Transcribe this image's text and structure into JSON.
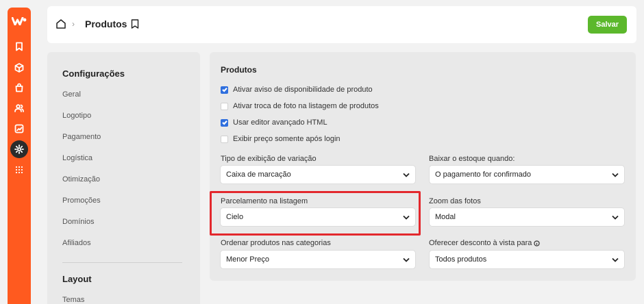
{
  "rail": {
    "items": [
      "bookmark-icon",
      "box-icon",
      "bag-icon",
      "users-icon",
      "chart-icon",
      "gear-icon",
      "grid-icon"
    ],
    "active": "gear-icon",
    "color": "#ff5a1f"
  },
  "header": {
    "page_title": "Produtos",
    "save_label": "Salvar"
  },
  "sidebar": {
    "section1": "Configurações",
    "items": [
      "Geral",
      "Logotipo",
      "Pagamento",
      "Logística",
      "Otimização",
      "Promoções",
      "Domínios",
      "Afiliados"
    ],
    "section2": "Layout",
    "items2": [
      "Temas"
    ]
  },
  "panel": {
    "title": "Produtos",
    "checkboxes": [
      {
        "label": "Ativar aviso de disponibilidade de produto",
        "checked": true
      },
      {
        "label": "Ativar troca de foto na listagem de produtos",
        "checked": false
      },
      {
        "label": "Usar editor avançado HTML",
        "checked": true
      },
      {
        "label": "Exibir preço somente após login",
        "checked": false
      }
    ],
    "fields": {
      "variacao": {
        "label": "Tipo de exibição de variação",
        "value": "Caixa de marcação"
      },
      "estoque": {
        "label": "Baixar o estoque quando:",
        "value": "O pagamento for confirmado"
      },
      "parcelamento": {
        "label": "Parcelamento na listagem",
        "value": "Cielo"
      },
      "zoom": {
        "label": "Zoom das fotos",
        "value": "Modal"
      },
      "ordenar": {
        "label": "Ordenar produtos nas categorias",
        "value": "Menor Preço"
      },
      "desconto": {
        "label": "Oferecer desconto à vista para",
        "value": "Todos produtos"
      }
    }
  },
  "colors": {
    "accent": "#ff5a1f",
    "save": "#5cb82c",
    "checkbox": "#2f6fde",
    "highlight": "#e3282d"
  }
}
